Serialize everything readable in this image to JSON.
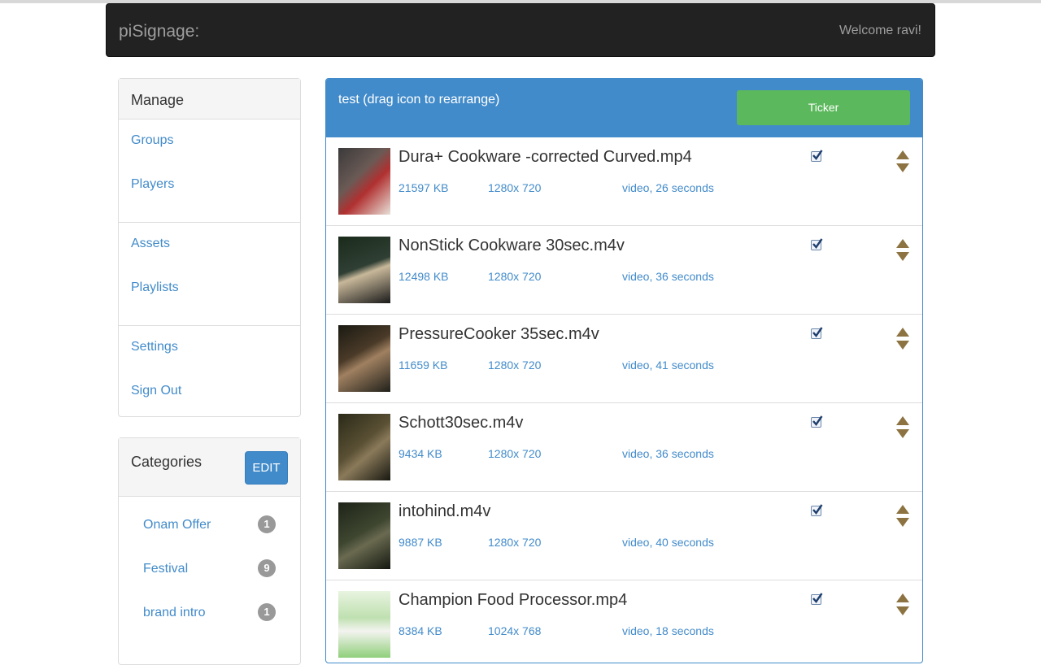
{
  "navbar": {
    "brand": "piSignage:",
    "welcome": "Welcome ravi!"
  },
  "sidebar": {
    "manage_title": "Manage",
    "groups": [
      [
        "Groups",
        "Players"
      ],
      [
        "Assets",
        "Playlists"
      ],
      [
        "Settings",
        "Sign Out"
      ]
    ],
    "categories_title": "Categories",
    "edit_label": "EDIT",
    "categories": [
      {
        "label": "Onam Offer",
        "count": "1"
      },
      {
        "label": "Festival",
        "count": "9"
      },
      {
        "label": "brand intro",
        "count": "1"
      }
    ]
  },
  "playlist": {
    "title": "test (drag icon to rearrange)",
    "ticker_label": "Ticker",
    "assets": [
      {
        "name": "Dura+ Cookware -corrected Curved.mp4",
        "size": "21597 KB",
        "resolution": "1280x 720",
        "duration": "video, 26 seconds",
        "selected": true
      },
      {
        "name": "NonStick Cookware 30sec.m4v",
        "size": "12498 KB",
        "resolution": "1280x 720",
        "duration": "video, 36 seconds",
        "selected": true
      },
      {
        "name": "PressureCooker 35sec.m4v",
        "size": "11659 KB",
        "resolution": "1280x 720",
        "duration": "video, 41 seconds",
        "selected": true
      },
      {
        "name": "Schott30sec.m4v",
        "size": "9434 KB",
        "resolution": "1280x 720",
        "duration": "video, 36 seconds",
        "selected": true
      },
      {
        "name": "intohind.m4v",
        "size": "9887 KB",
        "resolution": "1280x 720",
        "duration": "video, 40 seconds",
        "selected": true
      },
      {
        "name": "Champion Food Processor.mp4",
        "size": "8384 KB",
        "resolution": "1024x 768",
        "duration": "video, 18 seconds",
        "selected": true
      }
    ]
  },
  "colors": {
    "primary": "#428bca",
    "success": "#5cb85c",
    "navbar": "#222222",
    "drag_arrow": "#8c7341"
  }
}
